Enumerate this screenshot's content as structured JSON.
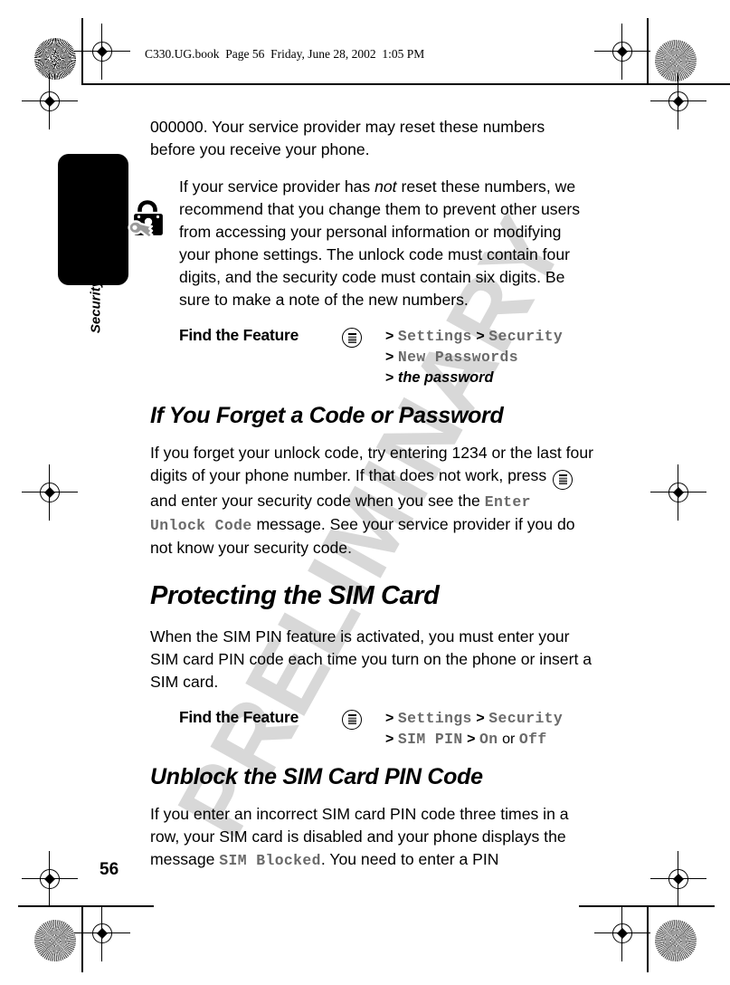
{
  "header": {
    "file_line": "C330.UG.book  Page 56  Friday, June 28, 2002  1:05 PM"
  },
  "watermark": {
    "text": "PRELIMINARY"
  },
  "sidebar": {
    "tab_label": "Security",
    "icon": "lock-and-key-icon"
  },
  "page_number": "56",
  "body": {
    "para1": "000000. Your service provider may reset these numbers before you receive your phone.",
    "para2_a": "If your service provider has ",
    "para2_italic": "not",
    "para2_b": " reset these numbers, we recommend that you change them to prevent other users from accessing your personal information or modifying your phone settings. The unlock code must contain four digits, and the security code must contain six digits. Be sure to make a note of the new numbers."
  },
  "find_the_feature_1": {
    "label": "Find the Feature",
    "key_icon": "menu-key-icon",
    "lines": [
      {
        "gt": ">",
        "item": "Settings",
        "gt2": ">",
        "item2": "Security"
      },
      {
        "gt": ">",
        "item": "New Passwords"
      },
      {
        "gt": ">",
        "italic_item": "the password"
      }
    ]
  },
  "section_forget": {
    "heading": "If You Forget a Code or Password",
    "text_a": "If you forget your unlock code, try entering 1234 or the last four digits of your phone number. If that does not work, press ",
    "text_b": " and enter your security code when you see the ",
    "mono": "Enter Unlock Code",
    "text_c": " message. See your service provider if you do not know your security code."
  },
  "section_sim": {
    "heading": "Protecting the SIM Card",
    "text": "When the SIM PIN feature is activated, you must enter your SIM card PIN code each time you turn on the phone or insert a SIM card."
  },
  "find_the_feature_2": {
    "label": "Find the Feature",
    "key_icon": "menu-key-icon",
    "lines": [
      {
        "gt": ">",
        "item": "Settings",
        "gt2": ">",
        "item2": "Security"
      },
      {
        "gt": ">",
        "item": "SIM PIN",
        "gt2": ">",
        "item2": "On",
        "conj": "or",
        "item3": "Off"
      }
    ]
  },
  "section_unblock": {
    "heading": "Unblock the SIM Card PIN Code",
    "text_a": "If you enter an incorrect SIM card PIN code three times in a row, your SIM card is disabled and your phone displays the message ",
    "mono": "SIM Blocked",
    "text_b": ". You need to enter a PIN"
  }
}
